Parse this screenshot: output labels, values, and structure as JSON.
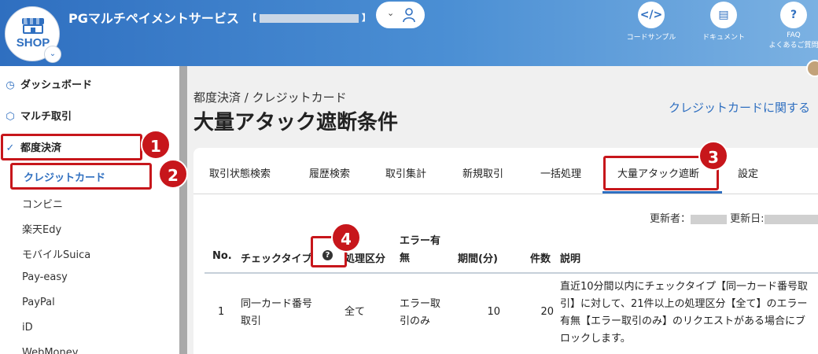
{
  "header": {
    "logo_text": "SHOP",
    "brand": "PGマルチペイメントサービス",
    "shop_id_open": "【",
    "shop_id_close": "】",
    "tools": [
      {
        "label": "コードサンプル",
        "icon": "code-icon"
      },
      {
        "label": "ドキュメント",
        "icon": "book-icon"
      },
      {
        "label": "FAQ",
        "label2": "よくあるご質問",
        "icon": "question-icon"
      }
    ]
  },
  "sidebar": {
    "items": [
      {
        "label": "ダッシュボード",
        "icon": "clock-icon"
      },
      {
        "label": "マルチ取引",
        "icon": "cube-icon"
      },
      {
        "label": "都度決済",
        "icon": "check-circle-icon"
      }
    ],
    "sub_items": [
      "クレジットカード",
      "コンビニ",
      "楽天Edy",
      "モバイルSuica",
      "Pay-easy",
      "PayPal",
      "iD",
      "WebMoney"
    ]
  },
  "main": {
    "breadcrumb": "都度決済 / クレジットカード",
    "title": "大量アタック遮断条件",
    "right_link": "クレジットカードに関する",
    "tabs": [
      "取引状態検索",
      "履歴検索",
      "取引集計",
      "新規取引",
      "一括処理",
      "大量アタック遮断",
      "設定"
    ],
    "updated_by_label": "更新者：",
    "updated_at_label": "更新日:",
    "table": {
      "headers": [
        "No.",
        "チェックタイプ",
        "処理区分",
        "エラー有無",
        "期間(分)",
        "件数",
        "説明"
      ],
      "rows": [
        {
          "no": "1",
          "check_type": "同一カード番号取引",
          "process_type": "全て",
          "error": "エラー取引のみ",
          "period": "10",
          "count": "20",
          "description": "直近10分間以内にチェックタイプ【同一カード番号取引】に対して、21件以上の処理区分【全て】のエラー有無【エラー取引のみ】のリクエストがある場合にブロックします。"
        }
      ]
    }
  },
  "annotations": [
    "1",
    "2",
    "3",
    "4"
  ],
  "colors": {
    "accent": "#2f6fc0",
    "annotation": "#c7161b"
  }
}
